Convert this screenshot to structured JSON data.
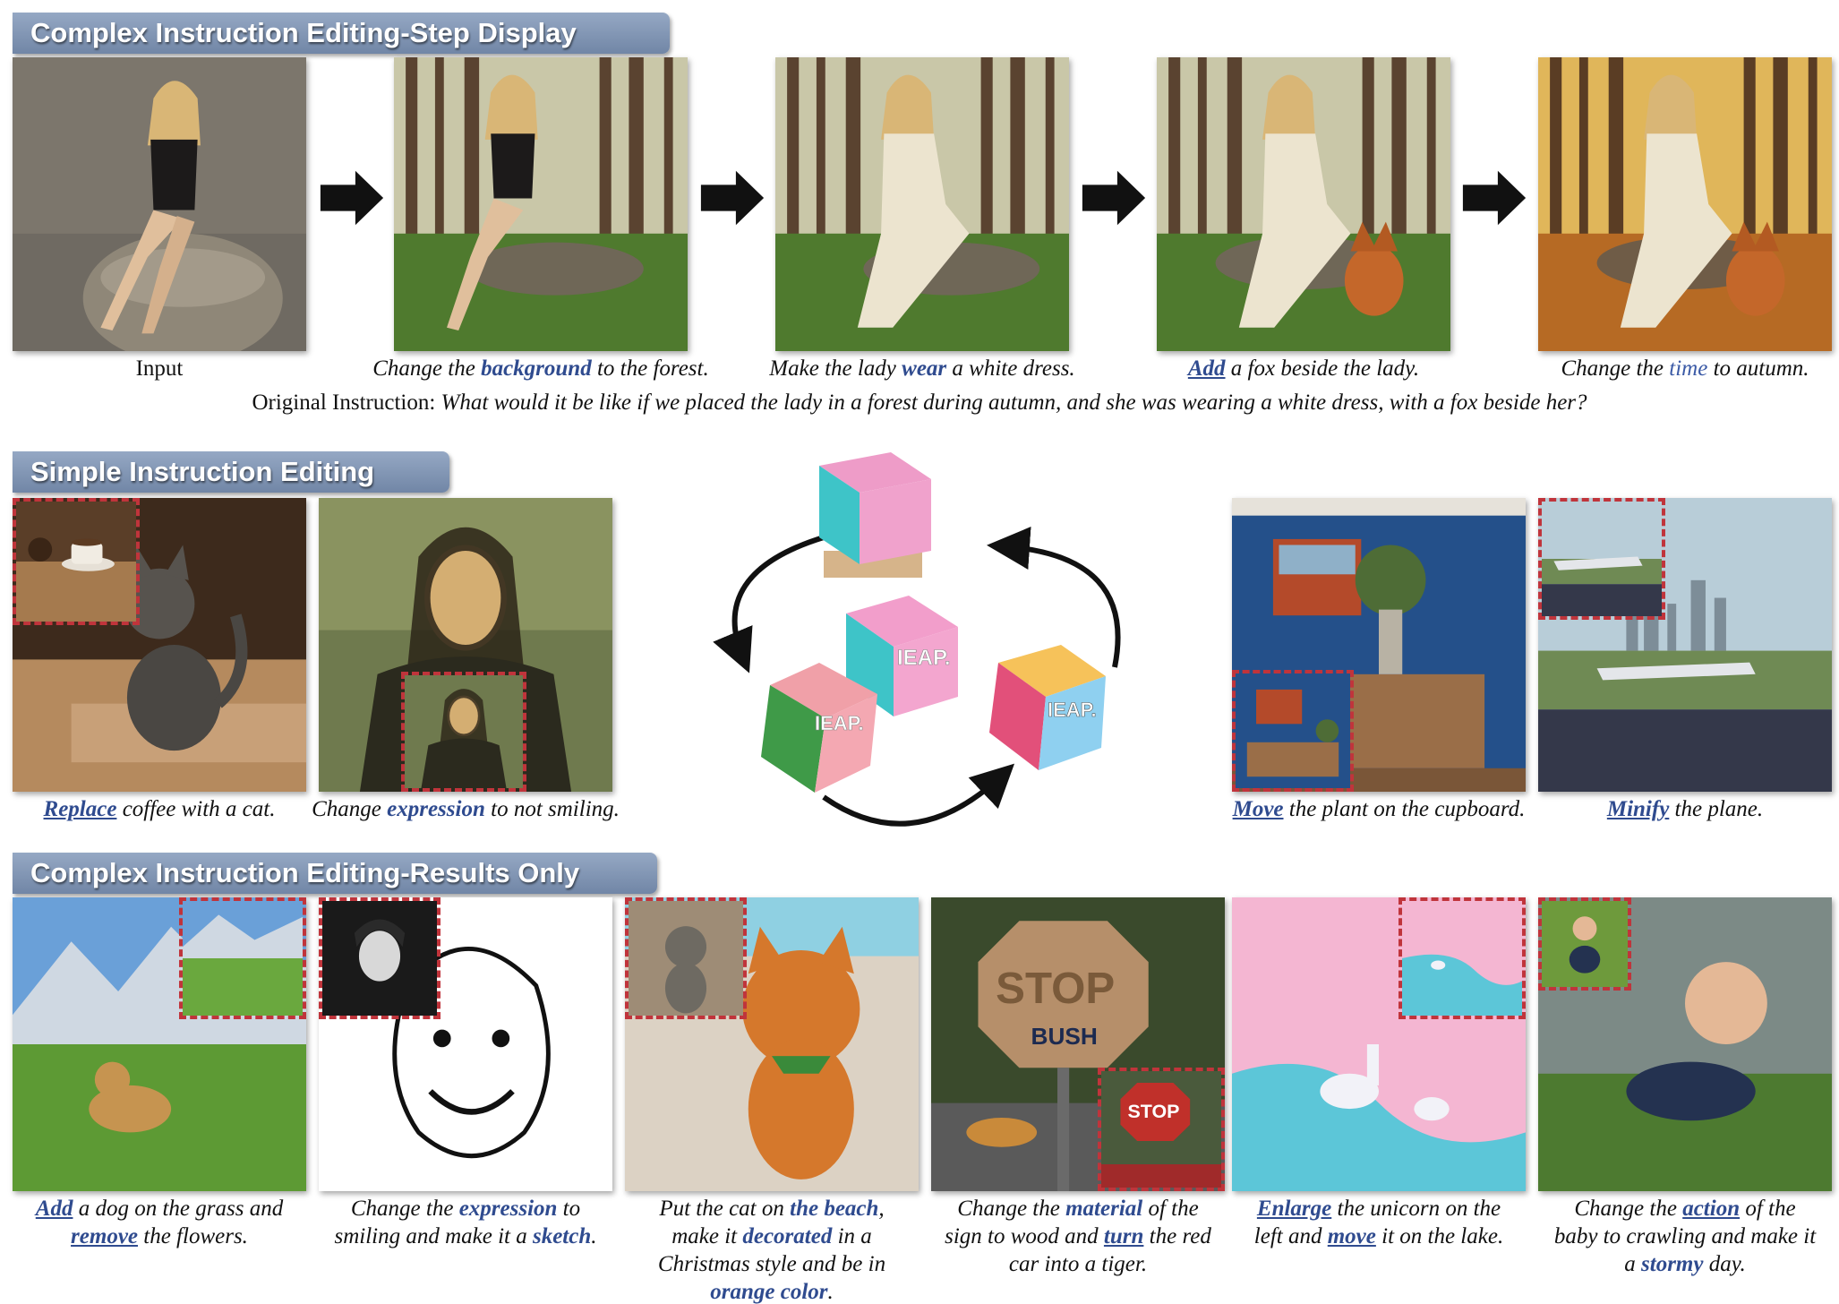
{
  "sections": {
    "step_display": "Complex Instruction Editing-Step Display",
    "simple": "Simple Instruction Editing",
    "results_only": "Complex Instruction Editing-Results Only"
  },
  "step_row": {
    "input_label": "Input",
    "captions": [
      {
        "pre": "Change the ",
        "kw": "background",
        "post": " to the forest."
      },
      {
        "pre": "Make the lady ",
        "kw": "wear",
        "post": " a white dress."
      },
      {
        "pre": "",
        "kw": "Add",
        "post": " a fox beside the lady."
      },
      {
        "pre": "Change the ",
        "kw": "time",
        "post": " to autumn."
      }
    ],
    "original_prefix": "Original Instruction: ",
    "original_text": "What would it be like if we placed the lady in a forest during autumn, and she was wearing a white dress, with a fox beside her?"
  },
  "simple_row": {
    "captions": [
      {
        "kw": "Replace",
        "post": " coffee with a cat."
      },
      {
        "pre": "Change ",
        "kw": "expression",
        "post": " to not smiling."
      },
      {
        "kw": "Move",
        "post": " the plant on the cupboard."
      },
      {
        "kw": "Minify",
        "post": " the plane."
      }
    ],
    "cube_text": "IEAP."
  },
  "results_row": {
    "captions": [
      {
        "l1a": "Add",
        "l1b": " a dog on the grass and",
        "l2a": "remove",
        "l2b": " the flowers."
      },
      {
        "l1a": "Change the ",
        "l1b": "expression",
        "l1c": " to",
        "l2a": "smiling and make it a ",
        "l2b": "sketch",
        "l2c": "."
      },
      {
        "l1a": "Put the cat on ",
        "l1b": "the beach",
        "l1c": ",",
        "l2a": "make it ",
        "l2b": "decorated",
        "l2c": " in a",
        "l3": "Christmas style and be in",
        "l4a": "orange color",
        "l4b": "."
      },
      {
        "l1a": "Change the ",
        "l1b": "material",
        "l1c": " of the",
        "l2a": "sign to wood and ",
        "l2b": "turn",
        "l2c": " the red",
        "l3": "car into a tiger."
      },
      {
        "l1a": "Enlarge",
        "l1b": " the unicorn on the",
        "l2a": "left and ",
        "l2b": "move",
        "l2c": " it on the lake."
      },
      {
        "l1a": "Change the ",
        "l1b": "action",
        "l1c": " of the",
        "l2a": "baby to crawling and make it",
        "l3a": "a ",
        "l3b": "stormy",
        "l3c": " day."
      }
    ],
    "stop_sign": "STOP",
    "bush_sign": "BUSH"
  },
  "colors": {
    "banner": "#7f93b3",
    "keyword": "#2f4b8f",
    "inset_border": "#c0343b"
  }
}
